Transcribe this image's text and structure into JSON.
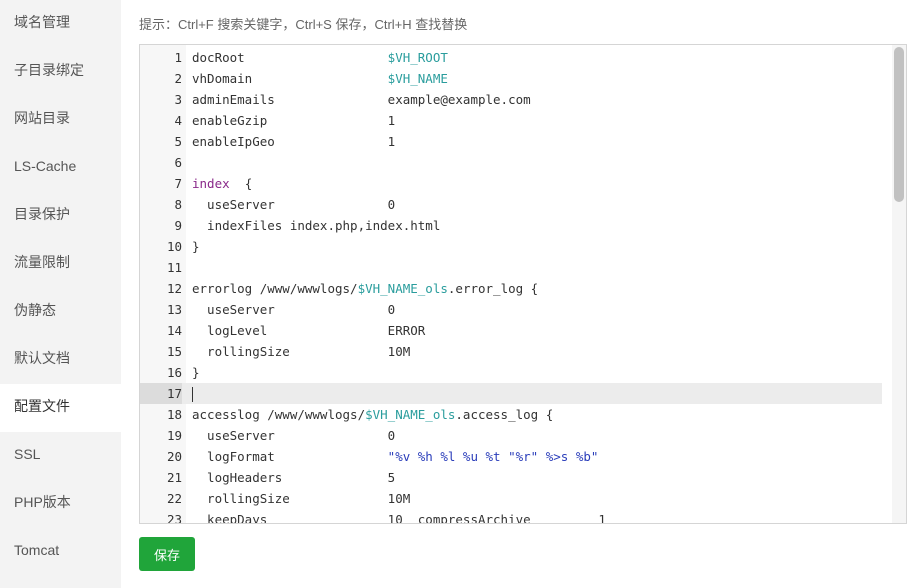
{
  "sidebar": {
    "items": [
      {
        "label": "域名管理"
      },
      {
        "label": "子目录绑定"
      },
      {
        "label": "网站目录"
      },
      {
        "label": "LS-Cache"
      },
      {
        "label": "目录保护"
      },
      {
        "label": "流量限制"
      },
      {
        "label": "伪静态"
      },
      {
        "label": "默认文档"
      },
      {
        "label": "配置文件",
        "active": true
      },
      {
        "label": "SSL"
      },
      {
        "label": "PHP版本"
      },
      {
        "label": "Tomcat"
      }
    ]
  },
  "main": {
    "tip": "提示：Ctrl+F 搜索关键字，Ctrl+S 保存，Ctrl+H 查找替换",
    "save_label": "保存",
    "accent_color": "#20a53a"
  },
  "editor": {
    "active_line": 17,
    "lines": [
      {
        "n": "1",
        "segs": [
          [
            "docRoot                   ",
            ""
          ],
          [
            "$VH_ROOT",
            "var"
          ]
        ]
      },
      {
        "n": "2",
        "segs": [
          [
            "vhDomain                  ",
            ""
          ],
          [
            "$VH_NAME",
            "var"
          ]
        ]
      },
      {
        "n": "3",
        "segs": [
          [
            "adminEmails               example@example.com",
            ""
          ]
        ]
      },
      {
        "n": "4",
        "segs": [
          [
            "enableGzip                1",
            ""
          ]
        ]
      },
      {
        "n": "5",
        "segs": [
          [
            "enableIpGeo               1",
            ""
          ]
        ]
      },
      {
        "n": "6",
        "segs": [
          [
            "",
            ""
          ]
        ]
      },
      {
        "n": "7",
        "segs": [
          [
            "index",
            "kw"
          ],
          [
            "  {",
            ""
          ]
        ]
      },
      {
        "n": "8",
        "segs": [
          [
            "  useServer               0",
            ""
          ]
        ]
      },
      {
        "n": "9",
        "segs": [
          [
            "  indexFiles index.php,index.html",
            ""
          ]
        ]
      },
      {
        "n": "10",
        "segs": [
          [
            "}",
            ""
          ]
        ]
      },
      {
        "n": "11",
        "segs": [
          [
            "",
            ""
          ]
        ]
      },
      {
        "n": "12",
        "segs": [
          [
            "errorlog /www/wwwlogs/",
            ""
          ],
          [
            "$VH_NAME_ols",
            "var"
          ],
          [
            ".error_log {",
            ""
          ]
        ]
      },
      {
        "n": "13",
        "segs": [
          [
            "  useServer               0",
            ""
          ]
        ]
      },
      {
        "n": "14",
        "segs": [
          [
            "  logLevel                ERROR",
            ""
          ]
        ]
      },
      {
        "n": "15",
        "segs": [
          [
            "  rollingSize             10M",
            ""
          ]
        ]
      },
      {
        "n": "16",
        "segs": [
          [
            "}",
            ""
          ]
        ]
      },
      {
        "n": "17",
        "segs": [
          [
            "",
            ""
          ]
        ]
      },
      {
        "n": "18",
        "segs": [
          [
            "accesslog /www/wwwlogs/",
            ""
          ],
          [
            "$VH_NAME_ols",
            "var"
          ],
          [
            ".access_log {",
            ""
          ]
        ]
      },
      {
        "n": "19",
        "segs": [
          [
            "  useServer               0",
            ""
          ]
        ]
      },
      {
        "n": "20",
        "segs": [
          [
            "  logFormat               ",
            ""
          ],
          [
            "\"%v %h %l %u %t \"%r\" %>s %b\"",
            "str"
          ]
        ]
      },
      {
        "n": "21",
        "segs": [
          [
            "  logHeaders              5",
            ""
          ]
        ]
      },
      {
        "n": "22",
        "segs": [
          [
            "  rollingSize             10M",
            ""
          ]
        ]
      },
      {
        "n": "23",
        "segs": [
          [
            "  keepDays                10  compressArchive         1",
            ""
          ]
        ]
      }
    ]
  }
}
